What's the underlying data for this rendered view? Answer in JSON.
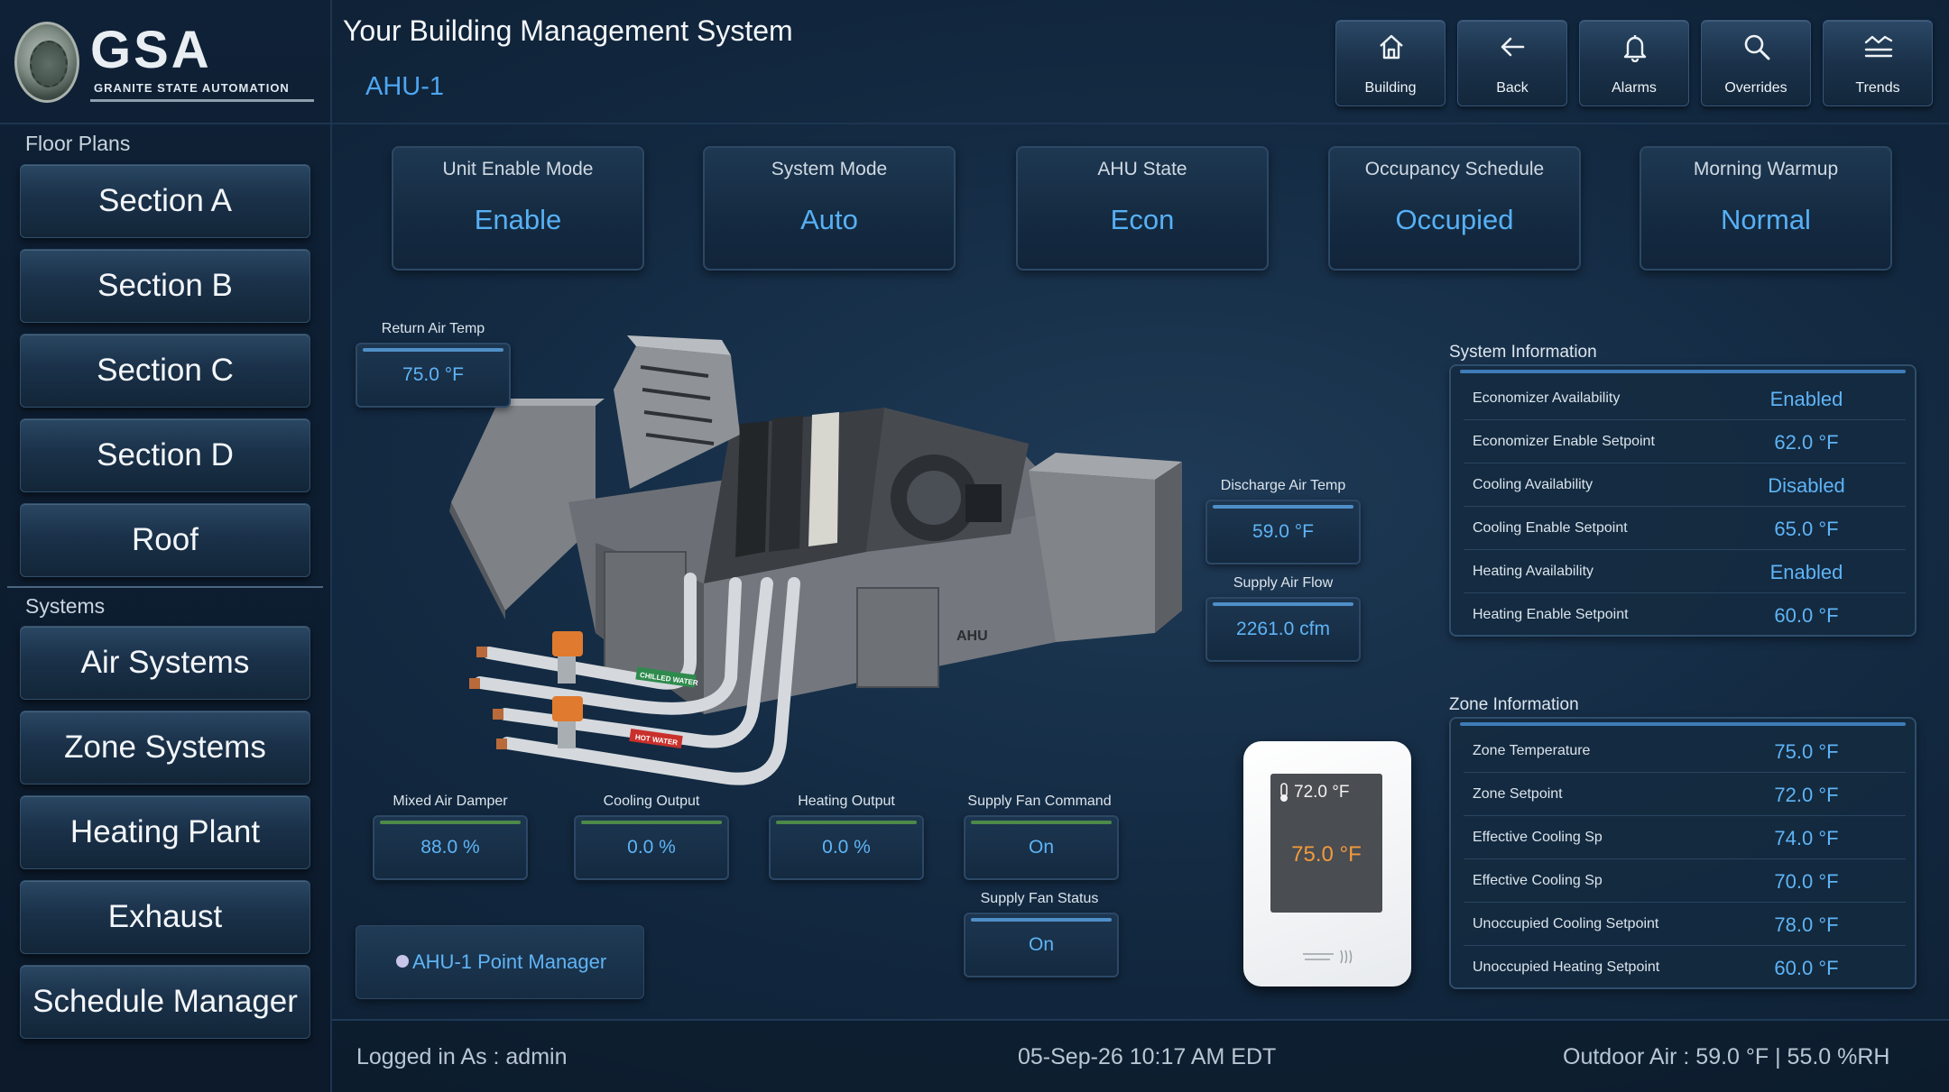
{
  "brand": {
    "logo_title": "GSA",
    "logo_subtitle": "GRANITE STATE AUTOMATION"
  },
  "header": {
    "app_title": "Your Building Management System",
    "page_name": "AHU-1"
  },
  "top_nav": [
    {
      "label": "Building",
      "icon": "home-icon"
    },
    {
      "label": "Back",
      "icon": "arrow-left-icon"
    },
    {
      "label": "Alarms",
      "icon": "bell-icon"
    },
    {
      "label": "Overrides",
      "icon": "search-icon"
    },
    {
      "label": "Trends",
      "icon": "trends-icon"
    }
  ],
  "sidebar": {
    "floor_plans_label": "Floor Plans",
    "floor_plans": [
      "Section A",
      "Section B",
      "Section C",
      "Section D",
      "Roof"
    ],
    "systems_label": "Systems",
    "systems": [
      "Air Systems",
      "Zone Systems",
      "Heating Plant",
      "Exhaust",
      "Schedule Manager"
    ]
  },
  "status_tiles": [
    {
      "title": "Unit Enable Mode",
      "value": "Enable"
    },
    {
      "title": "System Mode",
      "value": "Auto"
    },
    {
      "title": "AHU State",
      "value": "Econ"
    },
    {
      "title": "Occupancy Schedule",
      "value": "Occupied"
    },
    {
      "title": "Morning Warmup",
      "value": "Normal"
    }
  ],
  "points": {
    "return_air_temp": {
      "label": "Return Air Temp",
      "value": "75.0 °F"
    },
    "discharge_air_temp": {
      "label": "Discharge Air Temp",
      "value": "59.0 °F"
    },
    "supply_air_flow": {
      "label": "Supply Air Flow",
      "value": "2261.0 cfm"
    },
    "mixed_air_damper": {
      "label": "Mixed Air Damper",
      "value": "88.0 %"
    },
    "cooling_output": {
      "label": "Cooling Output",
      "value": "0.0 %"
    },
    "heating_output": {
      "label": "Heating Output",
      "value": "0.0 %"
    },
    "supply_fan_command": {
      "label": "Supply Fan Command",
      "value": "On"
    },
    "supply_fan_status": {
      "label": "Supply Fan Status",
      "value": "On"
    }
  },
  "diagram_labels": {
    "unit": "AHU",
    "chilled_water": "CHILLED WATER",
    "hot_water": "HOT WATER"
  },
  "point_manager": {
    "label": "AHU-1 Point Manager"
  },
  "thermostat": {
    "setpoint": "72.0 °F",
    "temperature": "75.0 °F"
  },
  "system_info": {
    "title": "System Information",
    "rows": [
      {
        "label": "Economizer Availability",
        "value": "Enabled"
      },
      {
        "label": "Economizer Enable Setpoint",
        "value": "62.0 °F"
      },
      {
        "label": "Cooling Availability",
        "value": "Disabled"
      },
      {
        "label": "Cooling Enable Setpoint",
        "value": "65.0 °F"
      },
      {
        "label": "Heating Availability",
        "value": "Enabled"
      },
      {
        "label": "Heating Enable Setpoint",
        "value": "60.0 °F"
      }
    ]
  },
  "zone_info": {
    "title": "Zone Information",
    "rows": [
      {
        "label": "Zone Temperature",
        "value": "75.0 °F"
      },
      {
        "label": "Zone Setpoint",
        "value": "72.0 °F"
      },
      {
        "label": "Effective Cooling Sp",
        "value": "74.0 °F"
      },
      {
        "label": "Effective Cooling Sp",
        "value": "70.0 °F"
      },
      {
        "label": "Unoccupied Cooling Setpoint",
        "value": "78.0 °F"
      },
      {
        "label": "Unoccupied Heating Setpoint",
        "value": "60.0 °F"
      }
    ]
  },
  "footer": {
    "logged_in": "Logged in As : admin",
    "datetime": "05-Sep-26 10:17 AM EDT",
    "outdoor_air": "Outdoor Air : 59.0 °F |  55.0 %RH"
  },
  "colors": {
    "accent": "#57b0f5",
    "background": "#132a42",
    "thermostat_temp": "#f39a3c"
  }
}
